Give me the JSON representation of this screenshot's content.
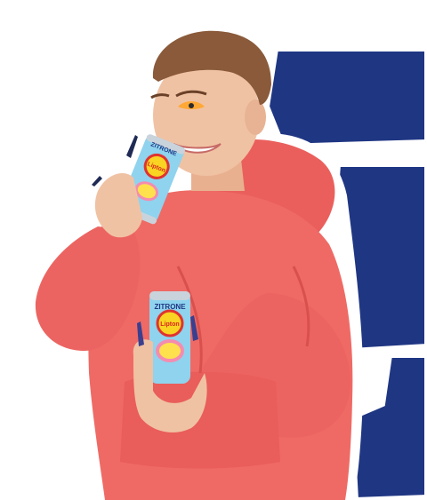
{
  "scene": {
    "background_color": "#ffffff",
    "accent_blue": "#1f3683",
    "hoodie_color": "#ef6a65",
    "can_color": "#8fd3ee",
    "skin_color": "#f0c2a4",
    "hair_color": "#8a5a3a"
  },
  "cans": {
    "top_can": {
      "brand": "Lipton",
      "flavor": "ZITRONE"
    },
    "bottom_can": {
      "brand": "Lipton",
      "flavor": "ZITRONE"
    }
  }
}
